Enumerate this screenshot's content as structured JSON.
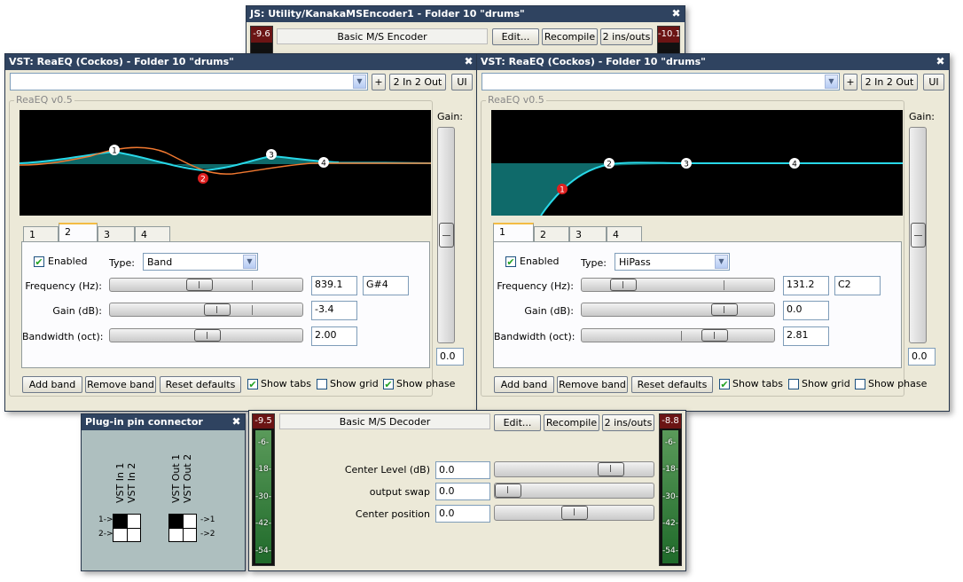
{
  "js_encoder": {
    "title": "JS: Utility/KanakaMSEncoder1 - Folder 10 \"drums\"",
    "left_meter": "-9.6",
    "right_meter": "-10.1",
    "name": "Basic M/S Encoder",
    "edit": "Edit...",
    "recompile": "Recompile",
    "ins_outs": "2 ins/outs"
  },
  "eq_left": {
    "title": "VST: ReaEQ (Cockos) - Folder 10 \"drums\"",
    "plus": "+",
    "io": "2 In 2 Out",
    "ui": "UI",
    "group": "ReaEQ v0.5",
    "gain_label": "Gain:",
    "gain_value": "0.0",
    "gain_level": 0.5,
    "nodes": [
      "1",
      "2",
      "3",
      "4"
    ],
    "tabs": [
      "1",
      "2",
      "3",
      "4"
    ],
    "active_tab": "2",
    "enabled_label": "Enabled",
    "enabled": true,
    "type_label": "Type:",
    "type_value": "Band",
    "freq_label": "Frequency (Hz):",
    "freq_value": "839.1",
    "freq_note": "G#4",
    "gain_db_label": "Gain (dB):",
    "gain_db_value": "-3.4",
    "bw_label": "Bandwidth (oct):",
    "bw_value": "2.00",
    "add_band": "Add band",
    "remove_band": "Remove band",
    "reset": "Reset defaults",
    "show_tabs": "Show tabs",
    "show_grid": "Show grid",
    "show_phase": "Show phase",
    "show_tabs_on": true,
    "show_grid_on": false,
    "show_phase_on": true
  },
  "eq_right": {
    "title": "VST: ReaEQ (Cockos) - Folder 10 \"drums\"",
    "plus": "+",
    "io": "2 In 2 Out",
    "ui": "UI",
    "group": "ReaEQ v0.5",
    "gain_label": "Gain:",
    "gain_value": "0.0",
    "gain_level": 0.5,
    "nodes": [
      "1",
      "2",
      "3",
      "4"
    ],
    "tabs": [
      "1",
      "2",
      "3",
      "4"
    ],
    "active_tab": "1",
    "enabled_label": "Enabled",
    "enabled": true,
    "type_label": "Type:",
    "type_value": "HiPass",
    "freq_label": "Frequency (Hz):",
    "freq_value": "131.2",
    "freq_note": "C2",
    "gain_db_label": "Gain (dB):",
    "gain_db_value": "0.0",
    "bw_label": "Bandwidth (oct):",
    "bw_value": "2.81",
    "add_band": "Add band",
    "remove_band": "Remove band",
    "reset": "Reset defaults",
    "show_tabs": "Show tabs",
    "show_grid": "Show grid",
    "show_phase": "Show phase",
    "show_tabs_on": true,
    "show_grid_on": false,
    "show_phase_on": false
  },
  "pin_connector": {
    "title": "Plug-in pin connector",
    "inputs": [
      "VST In 1",
      "VST In 2"
    ],
    "outputs": [
      "VST Out 1",
      "VST Out 2"
    ],
    "in_arrows": [
      "1->",
      "2->"
    ],
    "out_arrows": [
      "->1",
      "->2"
    ]
  },
  "js_decoder": {
    "left_meter": "-9.5",
    "right_meter": "-8.8",
    "meter_marks": [
      "-6-",
      "-18-",
      "-30-",
      "-42-",
      "-54-"
    ],
    "name": "Basic M/S Decoder",
    "edit": "Edit...",
    "recompile": "Recompile",
    "ins_outs": "2 ins/outs",
    "params": [
      {
        "label": "Center Level (dB)",
        "value": "0.0",
        "level": 0.78
      },
      {
        "label": "output swap",
        "value": "0.0",
        "level": 0.0
      },
      {
        "label": "Center position",
        "value": "0.0",
        "level": 0.5
      }
    ]
  },
  "colors": {
    "titlebar": "#2f4360",
    "graph_bg": "#000000",
    "eq_curve": "#28d8e8",
    "phase_curve": "#f07830",
    "eq_fill": "#0f6a6a",
    "node_selected": "#e02020",
    "meter_clip": "#6b1414"
  }
}
